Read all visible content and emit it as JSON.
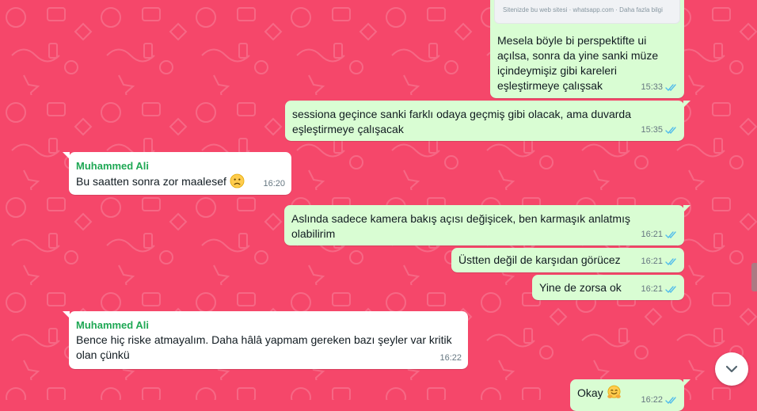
{
  "messages": [
    {
      "direction": "outgoing",
      "link_preview": "Sitenizde bu web sitesi · whatsapp.com · Daha fazla bilgi",
      "text": "Mesela böyle bi perspektifte ui açılsa, sonra da yine sanki müze içindeymişiz gibi kareleri eşleştirmeye çalışsak",
      "time": "15:33",
      "status": "read"
    },
    {
      "direction": "outgoing",
      "text": "sessiona geçince sanki farklı odaya geçmiş gibi olacak, ama duvarda eşleştirmeye çalışacak",
      "time": "15:35",
      "status": "read"
    },
    {
      "direction": "incoming",
      "sender": "Muhammed Ali",
      "text": "Bu saatten sonra zor maalesef",
      "emoji": "sad-face-emoji",
      "time": "16:20"
    },
    {
      "direction": "outgoing",
      "text": "Aslında sadece kamera bakış açısı değişicek, ben karmaşık anlatmış olabilirim",
      "time": "16:21",
      "status": "read"
    },
    {
      "direction": "outgoing",
      "text": "Üstten değil de karşıdan görücez",
      "time": "16:21",
      "status": "read"
    },
    {
      "direction": "outgoing",
      "text": "Yine de zorsa ok",
      "time": "16:21",
      "status": "read"
    },
    {
      "direction": "incoming",
      "sender": "Muhammed Ali",
      "text": "Bence hiç riske atmayalım. Daha hâlâ yapmam gereken bazı şeyler var kritik olan çünkü",
      "time": "16:22"
    },
    {
      "direction": "outgoing",
      "text": "Okay",
      "emoji": "hugging-face-emoji",
      "time": "16:22",
      "status": "read"
    }
  ],
  "colors": {
    "wallpaper": "#f5476a",
    "outgoing_bubble": "#d9fdd3",
    "incoming_bubble": "#ffffff",
    "sender_name": "#1fa855",
    "read_tick": "#53bdeb"
  },
  "icons": {
    "scroll_down": "chevron-down-icon",
    "read_receipt": "double-check-icon"
  }
}
